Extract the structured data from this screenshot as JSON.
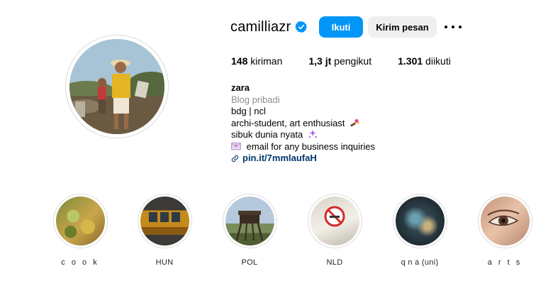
{
  "profile": {
    "username": "camilliazr",
    "verified": true,
    "follow_label": "Ikuti",
    "message_label": "Kirim pesan",
    "more_icon": "more-horizontal-icon"
  },
  "stats": {
    "posts_count": "148",
    "posts_label": "kiriman",
    "followers_count": "1,3 jt",
    "followers_label": "pengikut",
    "following_count": "1.301",
    "following_label": "diikuti"
  },
  "bio": {
    "name": "zara",
    "category": "Blog pribadi",
    "line1": "bdg | ncl",
    "line2": "archi-student, art enthusiast",
    "line3": "sibuk dunia nyata",
    "line4": "email for any business inquiries",
    "link": "pin.it/7mmlaufaH"
  },
  "highlights": [
    {
      "label": "c o o k"
    },
    {
      "label": "HUN"
    },
    {
      "label": "POL"
    },
    {
      "label": "NLD"
    },
    {
      "label": "q n a (uni)"
    },
    {
      "label": "a r t s"
    }
  ],
  "colors": {
    "accent": "#0095f6",
    "link": "#00376b",
    "muted": "#8e8e8e",
    "secondary_button": "#efefef"
  }
}
